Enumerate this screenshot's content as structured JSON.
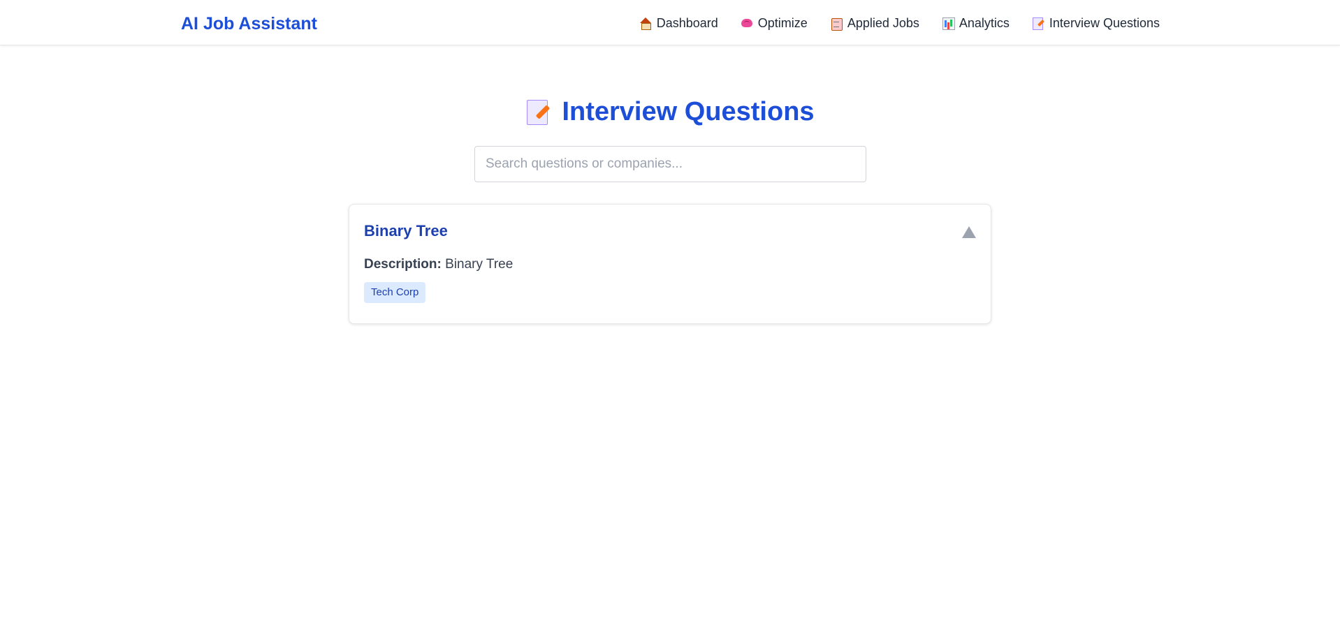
{
  "header": {
    "brand": "AI Job Assistant",
    "nav": [
      {
        "label": "Dashboard",
        "icon": "house-icon"
      },
      {
        "label": "Optimize",
        "icon": "brain-icon"
      },
      {
        "label": "Applied Jobs",
        "icon": "clipboard-icon"
      },
      {
        "label": "Analytics",
        "icon": "bar-chart-icon"
      },
      {
        "label": "Interview Questions",
        "icon": "memo-icon"
      }
    ]
  },
  "main": {
    "title": "Interview Questions",
    "title_icon": "memo-icon",
    "search": {
      "placeholder": "Search questions or companies...",
      "value": ""
    },
    "questions": [
      {
        "title": "Binary Tree",
        "description_label": "Description:",
        "description": "Binary Tree",
        "companies": [
          "Tech Corp"
        ],
        "expanded": true
      }
    ]
  },
  "colors": {
    "accent": "#1d4ed8",
    "card_title": "#1e40af",
    "tag_bg": "#dbeafe",
    "toggle": "#9ca3af"
  }
}
